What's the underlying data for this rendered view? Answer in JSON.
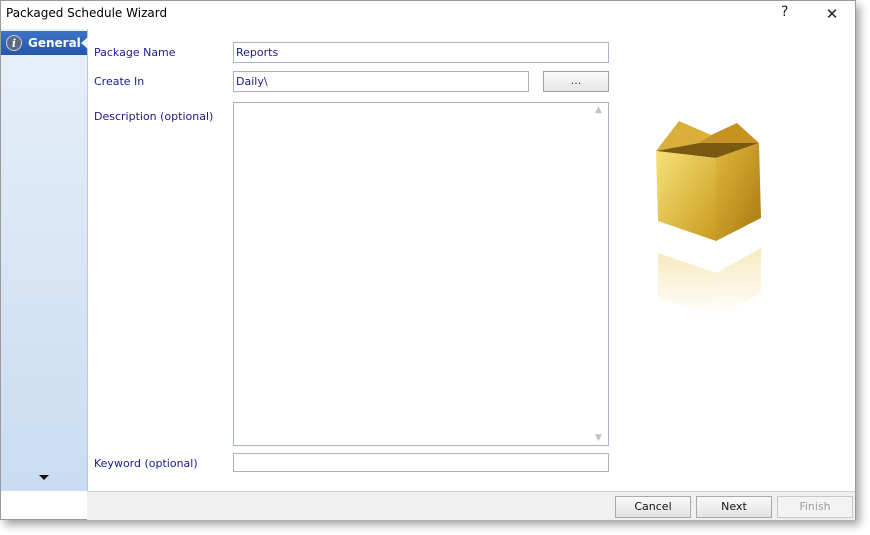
{
  "window": {
    "title": "Packaged Schedule Wizard",
    "help_glyph": "?",
    "close_glyph": "✕"
  },
  "sidebar": {
    "items": [
      {
        "label": "General",
        "icon": "info-icon",
        "selected": true
      }
    ],
    "info_glyph": "i"
  },
  "form": {
    "package_name_label": "Package Name",
    "package_name_value": "Reports",
    "create_in_label": "Create In",
    "create_in_value": "Daily\\",
    "browse_label": "...",
    "description_label": "Description (optional)",
    "description_value": "",
    "keyword_label": "Keyword (optional)",
    "keyword_value": ""
  },
  "footer": {
    "cancel_label": "Cancel",
    "next_label": "Next",
    "finish_label": "Finish"
  },
  "colors": {
    "accent": "#2456a8",
    "label_text": "#1a1a8c",
    "package_gold": "#e8c44a"
  }
}
